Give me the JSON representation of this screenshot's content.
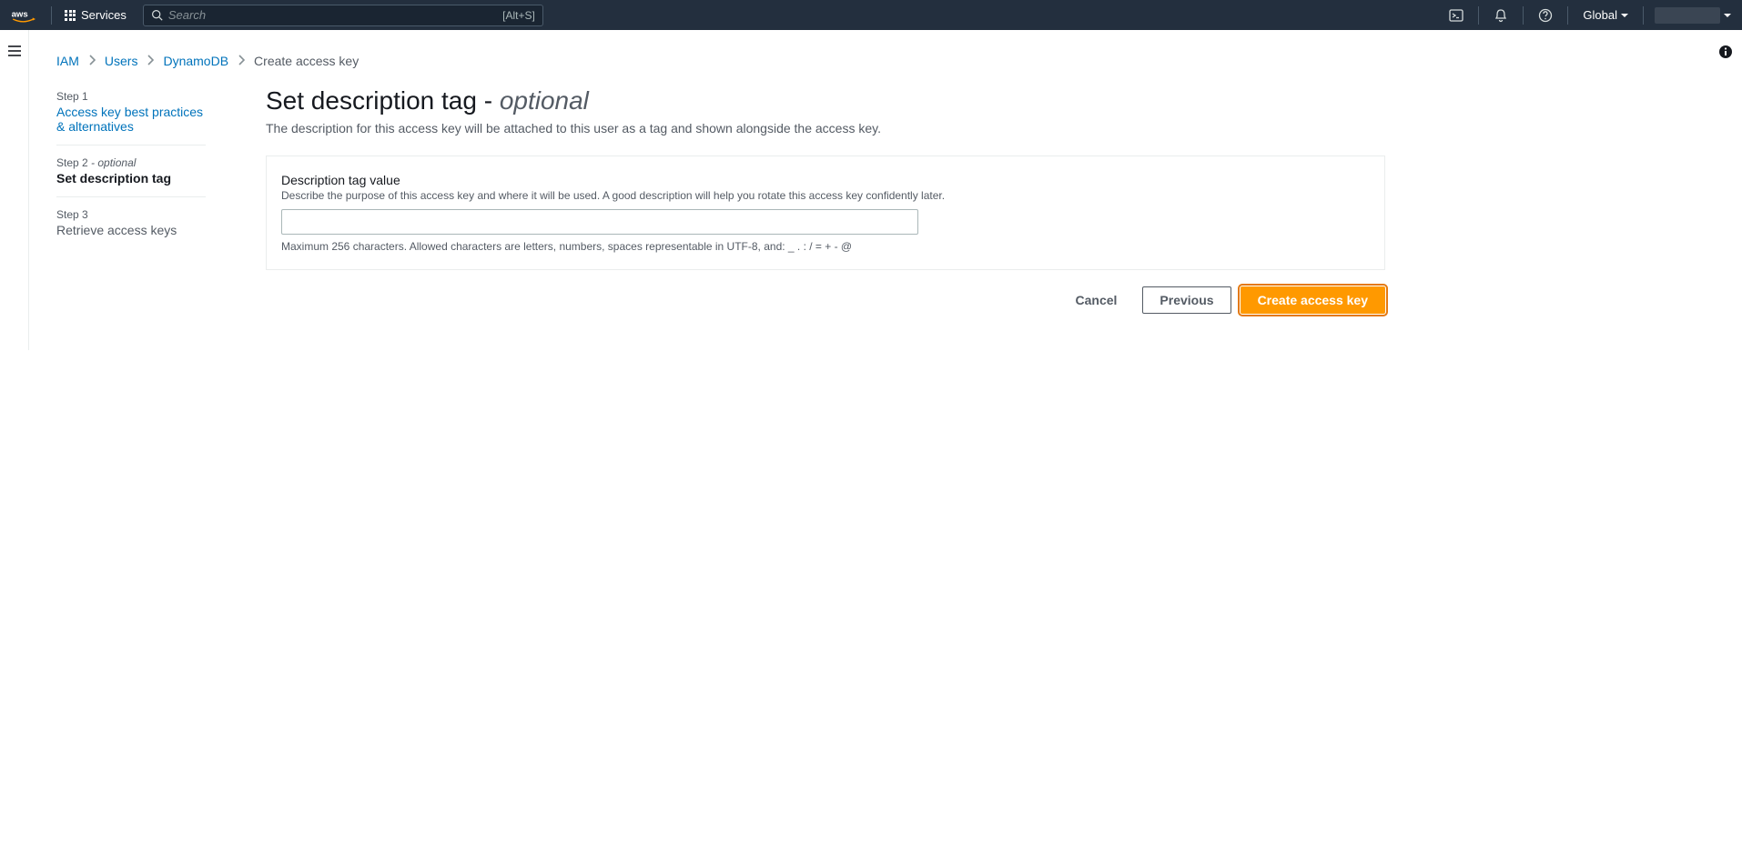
{
  "nav": {
    "services_label": "Services",
    "search_placeholder": "Search",
    "search_shortcut": "[Alt+S]",
    "region": "Global"
  },
  "breadcrumb": {
    "items": [
      "IAM",
      "Users",
      "DynamoDB"
    ],
    "current": "Create access key"
  },
  "wizard": {
    "steps": [
      {
        "label": "Step 1",
        "optional": false,
        "title": "Access key best practices & alternatives",
        "state": "link"
      },
      {
        "label": "Step 2",
        "optional": true,
        "title": "Set description tag",
        "state": "active"
      },
      {
        "label": "Step 3",
        "optional": false,
        "title": "Retrieve access keys",
        "state": "future"
      }
    ],
    "optional_suffix": " - optional"
  },
  "page": {
    "heading_main": "Set description tag",
    "heading_dash": " - ",
    "heading_opt": "optional",
    "description": "The description for this access key will be attached to this user as a tag and shown alongside the access key."
  },
  "field": {
    "label": "Description tag value",
    "hint": "Describe the purpose of this access key and where it will be used. A good description will help you rotate this access key confidently later.",
    "value": "",
    "constraint": "Maximum 256 characters. Allowed characters are letters, numbers, spaces representable in UTF-8, and: _ . : / = + - @"
  },
  "buttons": {
    "cancel": "Cancel",
    "previous": "Previous",
    "create": "Create access key"
  }
}
